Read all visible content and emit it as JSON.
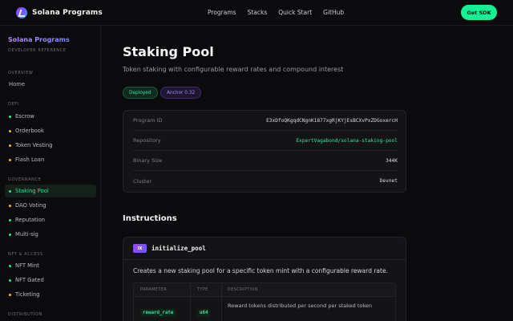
{
  "header": {
    "brand": "Solana Programs",
    "nav": [
      "Programs",
      "Stacks",
      "Quick Start",
      "GitHub"
    ],
    "cta": "Get SDK"
  },
  "sidebar": {
    "title": "Solana Programs",
    "subtitle": "DEVELOPER REFERENCE",
    "sections": [
      {
        "label": "OVERVIEW",
        "items": [
          {
            "label": "Home",
            "dot": ""
          }
        ]
      },
      {
        "label": "DEFI",
        "items": [
          {
            "label": "Escrow",
            "dot": "#14f195"
          },
          {
            "label": "Orderbook",
            "dot": "#f5b82e"
          },
          {
            "label": "Token Vesting",
            "dot": "#f5b82e"
          },
          {
            "label": "Flash Loan",
            "dot": "#f5b82e"
          }
        ]
      },
      {
        "label": "GOVERNANCE",
        "items": [
          {
            "label": "Staking Pool",
            "dot": "#14f195",
            "active": true
          },
          {
            "label": "DAO Voting",
            "dot": "#f5b82e"
          },
          {
            "label": "Reputation",
            "dot": "#14f195"
          },
          {
            "label": "Multi-sig",
            "dot": "#14f195"
          }
        ]
      },
      {
        "label": "NFT & ACCESS",
        "items": [
          {
            "label": "NFT Mint",
            "dot": "#14f195"
          },
          {
            "label": "NFT Gated",
            "dot": "#14f195"
          },
          {
            "label": "Ticketing",
            "dot": "#f5b82e"
          }
        ]
      },
      {
        "label": "DISTRIBUTION",
        "items": []
      }
    ]
  },
  "page": {
    "title": "Staking Pool",
    "description": "Token staking with configurable reward rates and compound interest",
    "badges": [
      "Deployed",
      "Anchor 0.32"
    ],
    "details": [
      {
        "key": "Program ID",
        "value": "E3xDfoQKgqdCNgnK1877xgRjKYjEsBCXvPxZDGoxercH"
      },
      {
        "key": "Repository",
        "value": "ExpertVagabond/solana-staking-pool"
      },
      {
        "key": "Binary Size",
        "value": "344K"
      },
      {
        "key": "Cluster",
        "value": "Devnet"
      }
    ],
    "instructions_heading": "Instructions",
    "instruction": {
      "tag": "IX",
      "name": "initialize_pool",
      "description": "Creates a new staking pool for a specific token mint with a configurable reward rate.",
      "columns": [
        "PARAMETER",
        "TYPE",
        "DESCRIPTION"
      ],
      "rows": [
        {
          "param": "reward_rate",
          "type": "u64",
          "desc": "Reward tokens distributed per second per staked token"
        }
      ]
    }
  },
  "colors": {
    "accent": "#14f195",
    "purple": "#9945ff",
    "warning": "#f5b82e"
  }
}
